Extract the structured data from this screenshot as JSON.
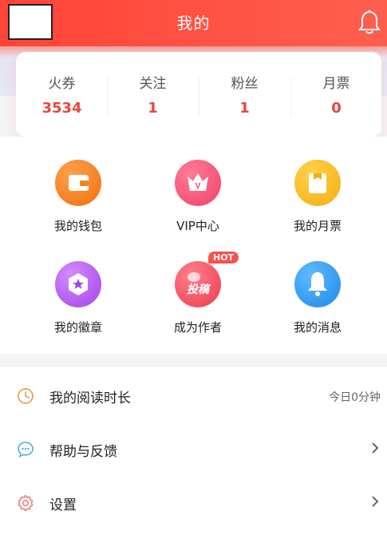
{
  "header": {
    "title": "我的"
  },
  "stats": [
    {
      "label": "火券",
      "value": "3534"
    },
    {
      "label": "关注",
      "value": "1"
    },
    {
      "label": "粉丝",
      "value": "1"
    },
    {
      "label": "月票",
      "value": "0"
    }
  ],
  "grid": [
    {
      "label": "我的钱包",
      "icon": "wallet-icon"
    },
    {
      "label": "VIP中心",
      "icon": "vip-crown-icon",
      "icon_text": "V"
    },
    {
      "label": "我的月票",
      "icon": "monthly-ticket-icon"
    },
    {
      "label": "我的徽章",
      "icon": "badge-icon"
    },
    {
      "label": "成为作者",
      "icon": "submit-manuscript-icon",
      "badge": "HOT",
      "icon_text": "投稿"
    },
    {
      "label": "我的消息",
      "icon": "bell-icon"
    }
  ],
  "list": [
    {
      "label": "我的阅读时长",
      "extra": "今日0分钟",
      "icon": "clock-icon"
    },
    {
      "label": "帮助与反馈",
      "icon": "chat-bubble-icon"
    },
    {
      "label": "设置",
      "icon": "gear-icon"
    }
  ],
  "colors": {
    "primary": "#ff4438",
    "accent_text": "#e8453c"
  }
}
